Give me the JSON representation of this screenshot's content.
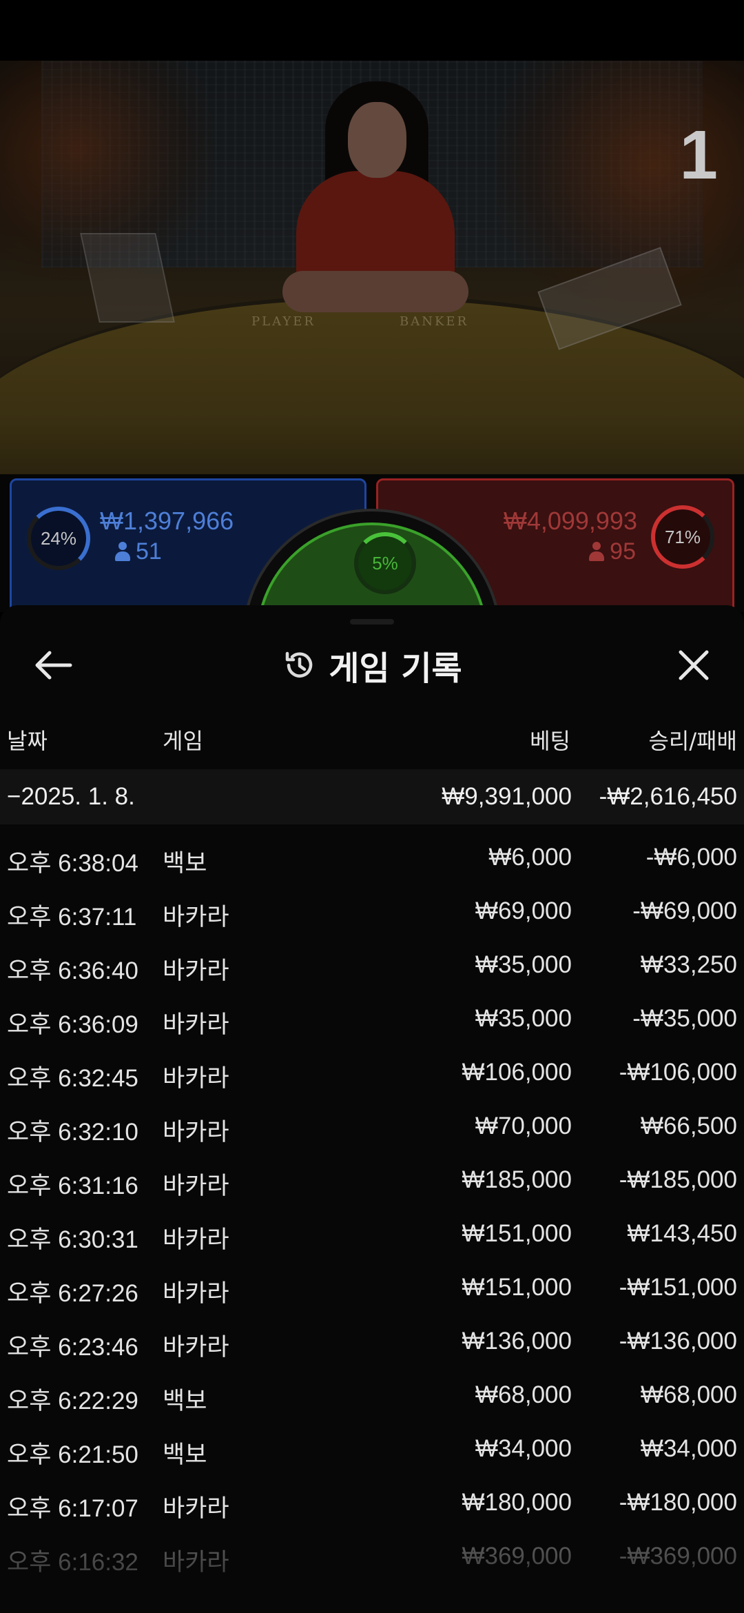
{
  "video": {
    "round_number": "1",
    "table_label_player": "PLAYER",
    "table_label_banker": "BANKER"
  },
  "bets": {
    "player": {
      "percent": "24%",
      "amount": "₩1,397,966",
      "count": "51",
      "color": "#4e7fd8"
    },
    "tie": {
      "percent": "5%",
      "color": "#49b53a"
    },
    "banker": {
      "percent": "71%",
      "amount": "₩4,099,993",
      "count": "95",
      "color": "#a03838"
    }
  },
  "sheet": {
    "title": "게임 기록",
    "icons": {
      "back": "arrow-left-icon",
      "history": "history-icon",
      "close": "close-icon"
    },
    "columns": {
      "date": "날짜",
      "game": "게임",
      "bet": "베팅",
      "win_loss": "승리/패배"
    },
    "summary": {
      "date": "−2025. 1. 8.",
      "bet": "₩9,391,000",
      "win_loss": "-₩2,616,450"
    },
    "rows": [
      {
        "time": "오후 6:38:04",
        "game": "백보",
        "bet": "₩6,000",
        "win_loss": "-₩6,000"
      },
      {
        "time": "오후 6:37:11",
        "game": "바카라",
        "bet": "₩69,000",
        "win_loss": "-₩69,000"
      },
      {
        "time": "오후 6:36:40",
        "game": "바카라",
        "bet": "₩35,000",
        "win_loss": "₩33,250"
      },
      {
        "time": "오후 6:36:09",
        "game": "바카라",
        "bet": "₩35,000",
        "win_loss": "-₩35,000"
      },
      {
        "time": "오후 6:32:45",
        "game": "바카라",
        "bet": "₩106,000",
        "win_loss": "-₩106,000"
      },
      {
        "time": "오후 6:32:10",
        "game": "바카라",
        "bet": "₩70,000",
        "win_loss": "₩66,500"
      },
      {
        "time": "오후 6:31:16",
        "game": "바카라",
        "bet": "₩185,000",
        "win_loss": "-₩185,000"
      },
      {
        "time": "오후 6:30:31",
        "game": "바카라",
        "bet": "₩151,000",
        "win_loss": "₩143,450"
      },
      {
        "time": "오후 6:27:26",
        "game": "바카라",
        "bet": "₩151,000",
        "win_loss": "-₩151,000"
      },
      {
        "time": "오후 6:23:46",
        "game": "바카라",
        "bet": "₩136,000",
        "win_loss": "-₩136,000"
      },
      {
        "time": "오후 6:22:29",
        "game": "백보",
        "bet": "₩68,000",
        "win_loss": "₩68,000"
      },
      {
        "time": "오후 6:21:50",
        "game": "백보",
        "bet": "₩34,000",
        "win_loss": "₩34,000"
      },
      {
        "time": "오후 6:17:07",
        "game": "바카라",
        "bet": "₩180,000",
        "win_loss": "-₩180,000"
      },
      {
        "time": "오후 6:16:32",
        "game": "바카라",
        "bet": "₩369,000",
        "win_loss": "-₩369,000"
      }
    ]
  }
}
